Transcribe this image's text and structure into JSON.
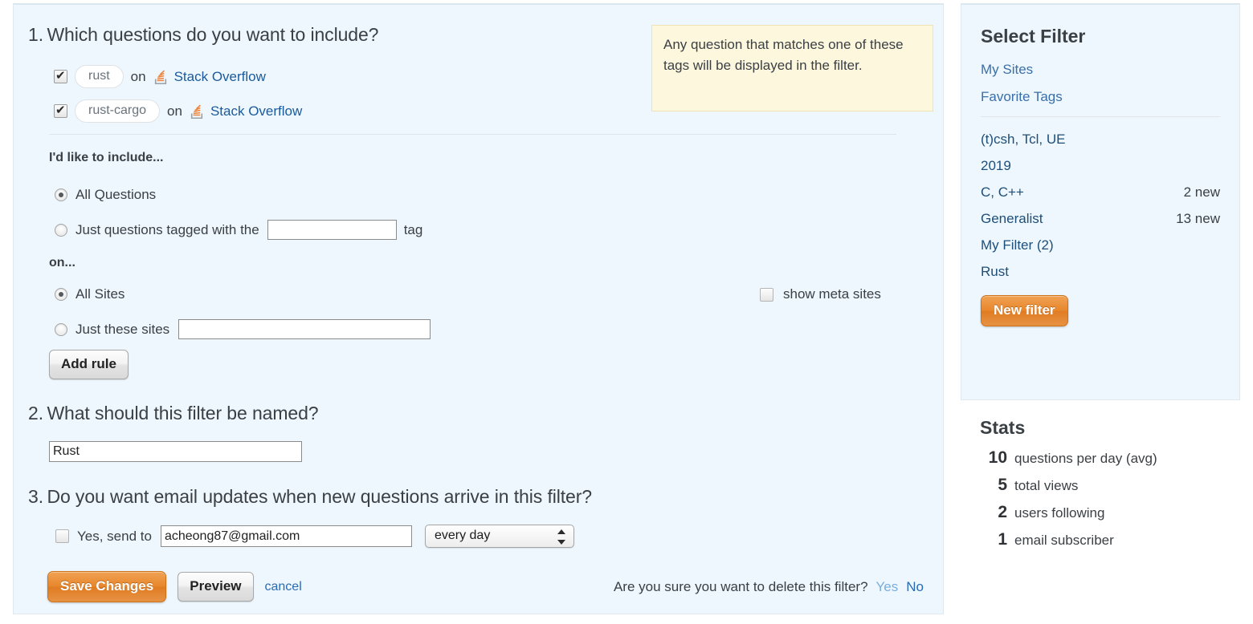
{
  "main": {
    "q1": {
      "number": "1.",
      "text": "Which questions do you want to include?",
      "rules": [
        {
          "checked": true,
          "tag": "rust",
          "on": "on",
          "site": "Stack Overflow"
        },
        {
          "checked": true,
          "tag": "rust-cargo",
          "on": "on",
          "site": "Stack Overflow"
        }
      ],
      "include_heading": "I'd like to include...",
      "include_options": [
        {
          "label": "All Questions",
          "selected": true
        },
        {
          "label_before": "Just questions tagged with the",
          "label_after": "tag",
          "selected": false,
          "value": "",
          "placeholder": ""
        }
      ],
      "on_heading": "on...",
      "site_options": [
        {
          "label": "All Sites",
          "selected": true
        },
        {
          "label": "Just these sites",
          "selected": false,
          "value": "",
          "placeholder": ""
        }
      ],
      "show_meta_label": "show meta sites",
      "show_meta_checked": false,
      "add_rule_label": "Add rule"
    },
    "tooltip": "Any question that matches one of these tags will be displayed in the filter.",
    "q2": {
      "number": "2.",
      "text": "What should this filter be named?",
      "name_value": "Rust",
      "name_placeholder": ""
    },
    "q3": {
      "number": "3.",
      "text": "Do you want email updates when new questions arrive in this filter?",
      "email_checked": false,
      "email_prefix": "Yes, send to",
      "email_value": "acheong87@gmail.com",
      "email_placeholder": "",
      "frequency_selected": "every day",
      "frequency_options": [
        "every day"
      ]
    },
    "footer": {
      "save_label": "Save Changes",
      "preview_label": "Preview",
      "cancel_label": "cancel",
      "delete_prompt": "Are you sure you want to delete this filter?",
      "delete_yes": "Yes",
      "delete_no": "No"
    }
  },
  "sidebar": {
    "title": "Select Filter",
    "links": [
      {
        "label": "My Sites"
      },
      {
        "label": "Favorite Tags"
      }
    ],
    "filters": [
      {
        "name": "(t)csh, Tcl, UE",
        "new": ""
      },
      {
        "name": "2019",
        "new": ""
      },
      {
        "name": "C, C++",
        "new": "2 new"
      },
      {
        "name": "Generalist",
        "new": "13 new"
      },
      {
        "name": "My Filter (2)",
        "new": ""
      },
      {
        "name": "Rust",
        "new": ""
      }
    ],
    "new_filter_label": "New filter"
  },
  "stats": {
    "title": "Stats",
    "rows": [
      {
        "num": "10",
        "label": "questions per day (avg)"
      },
      {
        "num": "5",
        "label": "total views"
      },
      {
        "num": "2",
        "label": "users following"
      },
      {
        "num": "1",
        "label": "email subscriber"
      }
    ]
  },
  "colors": {
    "panel_bg": "#edf7fd",
    "tooltip_bg": "#fdf7dd",
    "accent_orange": "#e8862b",
    "link_blue": "#1b5a9c"
  }
}
